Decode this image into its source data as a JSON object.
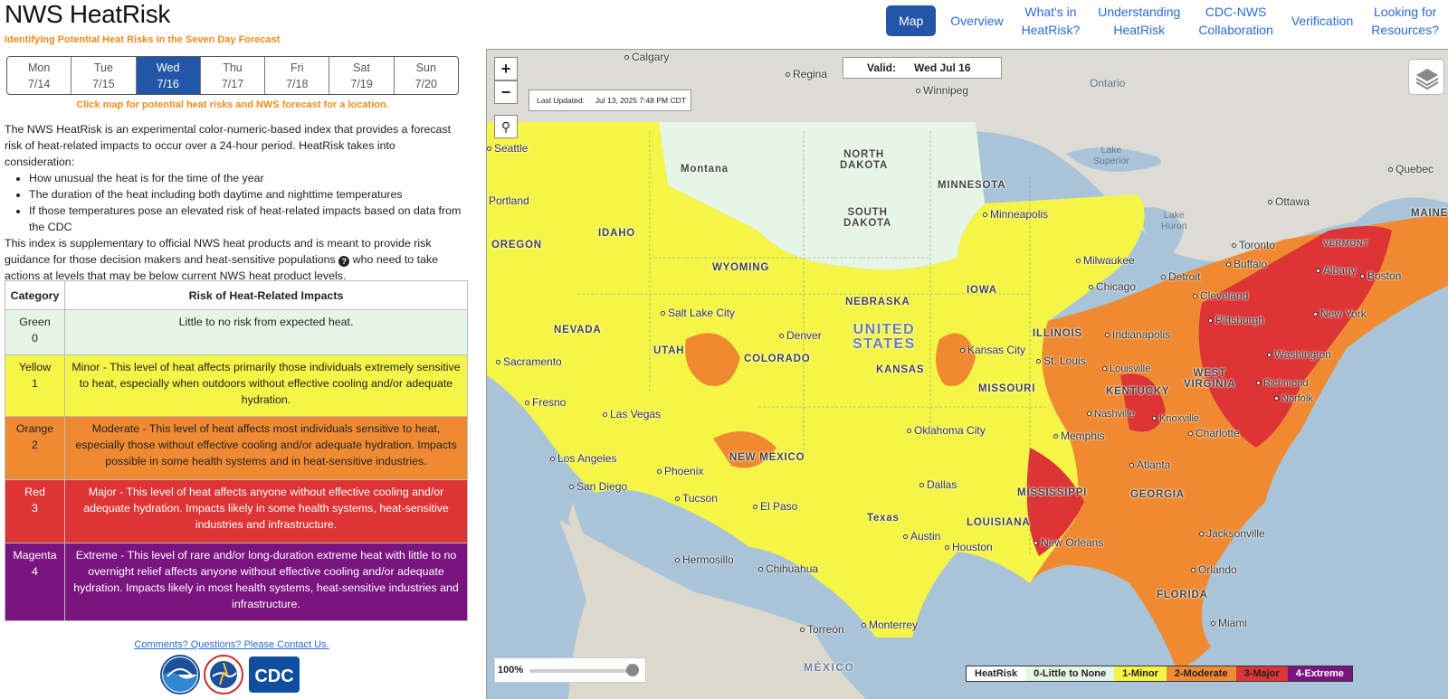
{
  "header": {
    "title": "NWS HeatRisk",
    "subtitle": "Identifying Potential Heat Risks in the Seven Day Forecast"
  },
  "nav": [
    {
      "label": "Map",
      "active": true
    },
    {
      "label": "Overview"
    },
    {
      "label": "What's in\nHeatRisk?"
    },
    {
      "label": "Understanding\nHeatRisk"
    },
    {
      "label": "CDC-NWS\nCollaboration"
    },
    {
      "label": "Verification"
    },
    {
      "label": "Looking for\nResources?"
    }
  ],
  "days": [
    {
      "day": "Mon",
      "date": "7/14"
    },
    {
      "day": "Tue",
      "date": "7/15"
    },
    {
      "day": "Wed",
      "date": "7/16",
      "active": true
    },
    {
      "day": "Thu",
      "date": "7/17"
    },
    {
      "day": "Fri",
      "date": "7/18"
    },
    {
      "day": "Sat",
      "date": "7/19"
    },
    {
      "day": "Sun",
      "date": "7/20"
    }
  ],
  "click_hint": "Click map for potential heat risks and NWS forecast for a location.",
  "description": {
    "intro": "The NWS HeatRisk is an experimental color-numeric-based index that provides a forecast risk of heat-related impacts to occur over a 24-hour period. HeatRisk takes into consideration:",
    "bullets": [
      "How unusual the heat is for the time of the year",
      "The duration of the heat including both daytime and nighttime temperatures",
      "If those temperatures pose an elevated risk of heat-related impacts based on data from the CDC"
    ],
    "outro_a": "This index is supplementary to official NWS heat products and is meant to provide risk guidance for those decision makers and heat-sensitive populations",
    "outro_b": "who need to take actions at levels that may be below current NWS heat product levels."
  },
  "table": {
    "headers": [
      "Category",
      "Risk of Heat-Related Impacts"
    ],
    "rows": [
      {
        "name": "Green",
        "level": "0",
        "text": "Little to no risk from expected heat."
      },
      {
        "name": "Yellow",
        "level": "1",
        "text": "Minor - This level of heat affects primarily those individuals extremely sensitive to heat, especially when outdoors without effective cooling and/or adequate hydration."
      },
      {
        "name": "Orange",
        "level": "2",
        "text": "Moderate - This level of heat affects most individuals sensitive to heat, especially those without effective cooling and/or adequate hydration. Impacts possible in some health systems and in heat-sensitive industries."
      },
      {
        "name": "Red",
        "level": "3",
        "text": "Major - This level of heat affects anyone without effective cooling and/or adequate hydration. Impacts likely in some health systems, heat-sensitive industries and infrastructure."
      },
      {
        "name": "Magenta",
        "level": "4",
        "text": "Extreme - This level of rare and/or long-duration extreme heat with little to no overnight relief affects anyone without effective cooling and/or adequate hydration. Impacts likely in most health systems, heat-sensitive industries and infrastructure."
      }
    ]
  },
  "contact_link": "Comments? Questions? Please Contact Us.",
  "logos": [
    "noaa-logo",
    "nws-logo",
    "cdc-logo"
  ],
  "logo_text": {
    "cdc": "CDC"
  },
  "map": {
    "valid_label": "Valid:",
    "valid_date": "Wed  Jul 16",
    "last_updated_label": "Last Updated:",
    "last_updated": "Jul 13, 2025 7:48 PM CDT",
    "zoom_in": "+",
    "zoom_out": "−",
    "opacity": "100%",
    "legend": [
      {
        "label": "HeatRisk",
        "color": "#ffffff"
      },
      {
        "label": "0-Little to None",
        "color": "#e6f6e6"
      },
      {
        "label": "1-Minor",
        "color": "#f5f547"
      },
      {
        "label": "2-Moderate",
        "color": "#ef8a33"
      },
      {
        "label": "3-Major",
        "color": "#dd3435"
      },
      {
        "label": "4-Extreme",
        "color": "#7a1580",
        "text_color": "#ffffff"
      }
    ],
    "places": [
      {
        "name": "Calgary",
        "kind": "city"
      },
      {
        "name": "Regina",
        "kind": "city"
      },
      {
        "name": "Winnipeg",
        "kind": "city"
      },
      {
        "name": "Ontario",
        "kind": "region"
      },
      {
        "name": "Seattle",
        "kind": "city"
      },
      {
        "name": "Portland",
        "kind": "city"
      },
      {
        "name": "Montana",
        "kind": "state"
      },
      {
        "name": "NORTH\nDAKOTA",
        "kind": "state"
      },
      {
        "name": "MINNESOTA",
        "kind": "state"
      },
      {
        "name": "OREGON",
        "kind": "state"
      },
      {
        "name": "IDAHO",
        "kind": "state"
      },
      {
        "name": "SOUTH\nDAKOTA",
        "kind": "state"
      },
      {
        "name": "Minneapolis",
        "kind": "city"
      },
      {
        "name": "WYOMING",
        "kind": "state"
      },
      {
        "name": "IOWA",
        "kind": "state"
      },
      {
        "name": "NEBRASKA",
        "kind": "state"
      },
      {
        "name": "NEVADA",
        "kind": "state"
      },
      {
        "name": "Salt Lake City",
        "kind": "city"
      },
      {
        "name": "UTAH",
        "kind": "state"
      },
      {
        "name": "COLORADO",
        "kind": "state"
      },
      {
        "name": "Denver",
        "kind": "city"
      },
      {
        "name": "UNITED\nSTATES",
        "kind": "country"
      },
      {
        "name": "KANSAS",
        "kind": "state"
      },
      {
        "name": "Kansas City",
        "kind": "city"
      },
      {
        "name": "MISSOURI",
        "kind": "state"
      },
      {
        "name": "ILLINOIS",
        "kind": "state"
      },
      {
        "name": "Sacramento",
        "kind": "city"
      },
      {
        "name": "Fresno",
        "kind": "city"
      },
      {
        "name": "Las Vegas",
        "kind": "city"
      },
      {
        "name": "Los Angeles",
        "kind": "city"
      },
      {
        "name": "San Diego",
        "kind": "city"
      },
      {
        "name": "Phoenix",
        "kind": "city"
      },
      {
        "name": "Tucson",
        "kind": "city"
      },
      {
        "name": "NEW MEXICO",
        "kind": "state"
      },
      {
        "name": "El Paso",
        "kind": "city"
      },
      {
        "name": "Oklahoma City",
        "kind": "city"
      },
      {
        "name": "Dallas",
        "kind": "city"
      },
      {
        "name": "Texas",
        "kind": "state"
      },
      {
        "name": "Austin",
        "kind": "city"
      },
      {
        "name": "Houston",
        "kind": "city"
      },
      {
        "name": "Hermosillo",
        "kind": "city"
      },
      {
        "name": "Chihuahua",
        "kind": "city"
      },
      {
        "name": "Torreón",
        "kind": "city"
      },
      {
        "name": "Monterrey",
        "kind": "city"
      },
      {
        "name": "MÉXICO",
        "kind": "country"
      },
      {
        "name": "Lake\nSuperior",
        "kind": "water"
      },
      {
        "name": "Lake\nHuron",
        "kind": "water"
      },
      {
        "name": "Milwaukee",
        "kind": "city"
      },
      {
        "name": "Chicago",
        "kind": "city"
      },
      {
        "name": "Detroit",
        "kind": "city"
      },
      {
        "name": "Toronto",
        "kind": "city"
      },
      {
        "name": "Ottawa",
        "kind": "city"
      },
      {
        "name": "Quebec",
        "kind": "city"
      },
      {
        "name": "MAINE",
        "kind": "state"
      },
      {
        "name": "VERMONT",
        "kind": "state"
      },
      {
        "name": "Albany",
        "kind": "city"
      },
      {
        "name": "Boston",
        "kind": "city"
      },
      {
        "name": "Buffalo",
        "kind": "city"
      },
      {
        "name": "Cleveland",
        "kind": "city"
      },
      {
        "name": "Pittsburgh",
        "kind": "city"
      },
      {
        "name": "New York",
        "kind": "city"
      },
      {
        "name": "Indianapolis",
        "kind": "city"
      },
      {
        "name": "St. Louis",
        "kind": "city"
      },
      {
        "name": "Louisville",
        "kind": "city"
      },
      {
        "name": "WEST\nVIRGINIA",
        "kind": "state"
      },
      {
        "name": "Washington",
        "kind": "city"
      },
      {
        "name": "KENTUCKY",
        "kind": "state"
      },
      {
        "name": "Richmond",
        "kind": "city"
      },
      {
        "name": "Norfolk",
        "kind": "city"
      },
      {
        "name": "Nashville",
        "kind": "city"
      },
      {
        "name": "Knoxville",
        "kind": "city"
      },
      {
        "name": "Memphis",
        "kind": "city"
      },
      {
        "name": "Charlotte",
        "kind": "city"
      },
      {
        "name": "Atlanta",
        "kind": "city"
      },
      {
        "name": "MISSISSIPPI",
        "kind": "state"
      },
      {
        "name": "GEORGIA",
        "kind": "state"
      },
      {
        "name": "LOUISIANA",
        "kind": "state"
      },
      {
        "name": "New Orleans",
        "kind": "city"
      },
      {
        "name": "Jacksonville",
        "kind": "city"
      },
      {
        "name": "Orlando",
        "kind": "city"
      },
      {
        "name": "FLORIDA",
        "kind": "state"
      },
      {
        "name": "Miami",
        "kind": "city"
      }
    ]
  }
}
